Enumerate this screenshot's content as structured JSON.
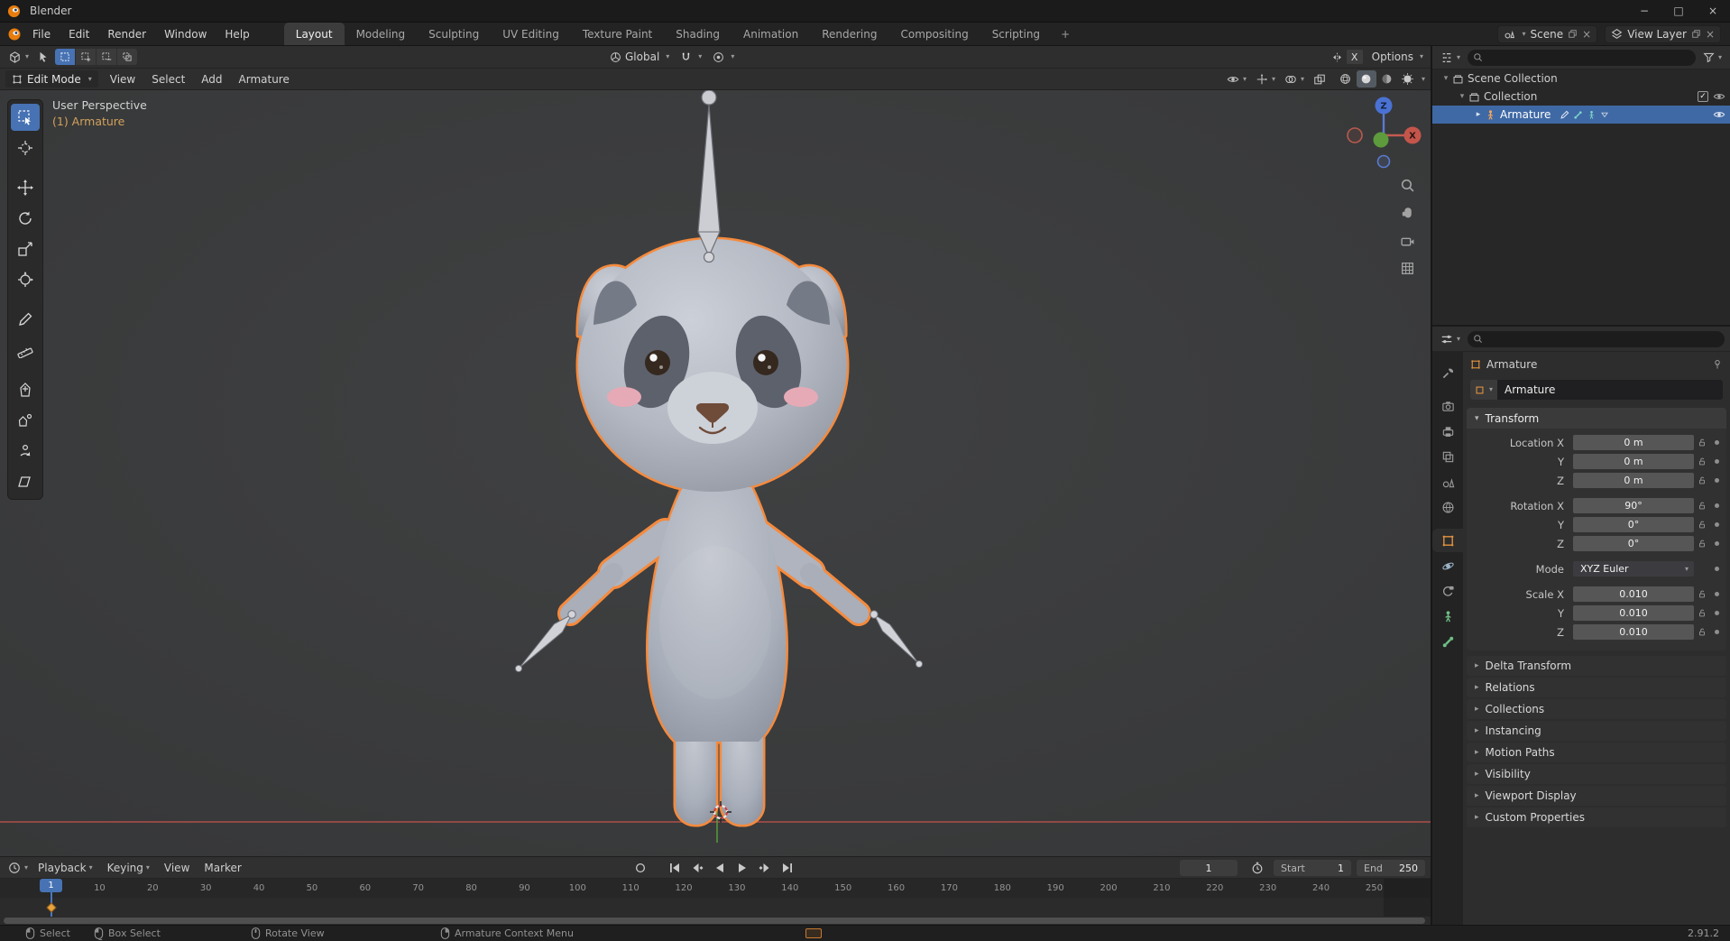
{
  "titlebar": {
    "title": "Blender"
  },
  "icons": {
    "chevron": "▾",
    "disclosure_open": "▾",
    "disclosure_closed": "▸",
    "minimize": "−",
    "maximize": "□",
    "close": "×",
    "check": "✓"
  },
  "topbar": {
    "menus": [
      "File",
      "Edit",
      "Render",
      "Window",
      "Help"
    ],
    "workspaces": [
      "Layout",
      "Modeling",
      "Sculpting",
      "UV Editing",
      "Texture Paint",
      "Shading",
      "Animation",
      "Rendering",
      "Compositing",
      "Scripting"
    ],
    "active_workspace": "Layout",
    "add_tab": "+",
    "scene_name": "Scene",
    "view_layer_name": "View Layer"
  },
  "tool_settings": {
    "orientation_label": "Global",
    "mirror_x_label": "X",
    "options_label": "Options"
  },
  "viewport_header": {
    "mode_label": "Edit Mode",
    "menus": [
      "View",
      "Select",
      "Add",
      "Armature"
    ]
  },
  "viewport_overlay": {
    "line1": "User Perspective",
    "line2": "(1) Armature"
  },
  "gizmo": {
    "x_label": "X",
    "z_label": "Z"
  },
  "toolbar": {
    "tools": [
      "select-box",
      "cursor",
      "move",
      "rotate",
      "scale",
      "transform",
      "annotate",
      "measure",
      "extrude",
      "extrude-to-cursor",
      "roll",
      "shear"
    ],
    "active_tool": "select-box"
  },
  "timeline": {
    "menus": [
      "Playback",
      "Keying",
      "View",
      "Marker"
    ],
    "current_frame": "1",
    "playhead_label": "1",
    "start_label": "Start",
    "start_value": "1",
    "end_label": "End",
    "end_value": "250",
    "ticks": [
      "10",
      "20",
      "30",
      "40",
      "50",
      "60",
      "70",
      "80",
      "90",
      "100",
      "110",
      "120",
      "130",
      "140",
      "150",
      "160",
      "170",
      "180",
      "190",
      "200",
      "210",
      "220",
      "230",
      "240",
      "250"
    ]
  },
  "outliner": {
    "rows": [
      {
        "label": "Scene Collection"
      },
      {
        "label": "Collection"
      },
      {
        "label": "Armature"
      }
    ]
  },
  "properties": {
    "context_name": "Armature",
    "object_name": "Armature",
    "transform_title": "Transform",
    "transform_rows": [
      {
        "label": "Location X",
        "value": "0 m"
      },
      {
        "label": "Y",
        "value": "0 m"
      },
      {
        "label": "Z",
        "value": "0 m"
      },
      {
        "label": "Rotation X",
        "value": "90°"
      },
      {
        "label": "Y",
        "value": "0°"
      },
      {
        "label": "Z",
        "value": "0°"
      },
      {
        "label": "Mode",
        "value": "XYZ Euler"
      },
      {
        "label": "Scale X",
        "value": "0.010"
      },
      {
        "label": "Y",
        "value": "0.010"
      },
      {
        "label": "Z",
        "value": "0.010"
      }
    ],
    "collapsed_panels": [
      "Delta Transform",
      "Relations",
      "Collections",
      "Instancing",
      "Motion Paths",
      "Visibility",
      "Viewport Display",
      "Custom Properties"
    ]
  },
  "statusbar": {
    "hints": [
      "Select",
      "Box Select",
      "Rotate View",
      "Armature Context Menu"
    ],
    "version": "2.91.2"
  },
  "colors": {
    "accent": "#4772b3",
    "selection_outline": "#f58a3d",
    "axis_x": "#c0504a",
    "axis_y": "#58a03c",
    "axis_z": "#4a71d4"
  }
}
